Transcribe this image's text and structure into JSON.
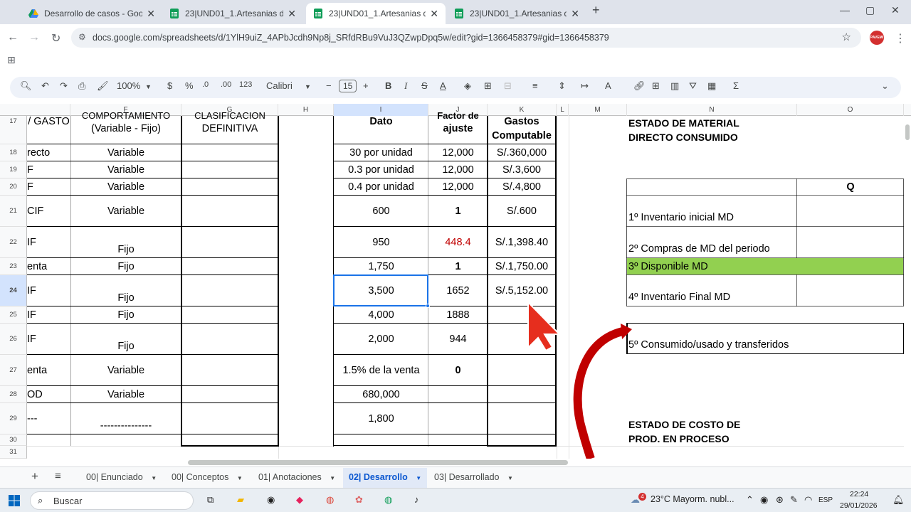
{
  "browser": {
    "tabs": [
      {
        "title": "Desarrollo de casos - Google D"
      },
      {
        "title": "23|UND01_1.Artesanias del Perú"
      },
      {
        "title": "23|UND01_1.Artesanias del Perú"
      },
      {
        "title": "23|UND01_1.Artesanias del Perú"
      }
    ],
    "url": "docs.google.com/spreadsheets/d/1YlH9uiZ_4APbJcdh9Np8j_SRfdRBu9VuJ3QZwpDpq5w/edit?gid=1366458379#gid=1366458379",
    "profile": "PAVEMI"
  },
  "toolbar": {
    "zoom": "100%",
    "currency": "$",
    "percent": "%",
    "dec_less": ".0",
    "dec_more": ".00",
    "number_format": "123",
    "font": "Calibri",
    "font_size": "15"
  },
  "columns": [
    {
      "label": "F"
    },
    {
      "label": "G"
    },
    {
      "label": "H"
    },
    {
      "label": "I"
    },
    {
      "label": "J"
    },
    {
      "label": "K"
    },
    {
      "label": "L"
    },
    {
      "label": "M"
    },
    {
      "label": "N"
    },
    {
      "label": "O"
    }
  ],
  "rows": [
    "17",
    "18",
    "19",
    "20",
    "21",
    "22",
    "23",
    "24",
    "25",
    "26",
    "27",
    "28",
    "29",
    "30",
    "31"
  ],
  "headers": {
    "e17": "/ GASTO",
    "f17_top": "COMPORTAMIENTO",
    "f17": "(Variable - Fijo)",
    "g17_top": "CLASIFICACION",
    "g17": "DEFINITIVA",
    "i17": "Dato",
    "j17_top": "Factor de",
    "j17": "ajuste",
    "k17_a": "Gastos",
    "k17_b": "Computable"
  },
  "table": {
    "e": [
      "recto",
      "F",
      "F",
      "CIF",
      "IF",
      "enta",
      "IF",
      "IF",
      "IF",
      "enta",
      "OD",
      "---"
    ],
    "f": [
      "Variable",
      "Variable",
      "Variable",
      "Variable",
      "Fijo",
      "Fijo",
      "Fijo",
      "Fijo",
      "Fijo",
      "Variable",
      "Variable",
      "---------------"
    ],
    "i": [
      "30 por unidad",
      "0.3 por unidad",
      "0.4 por unidad",
      "600",
      "950",
      "1,750",
      "3,500",
      "4,000",
      "2,000",
      "1.5% de la venta",
      "680,000",
      "1,800"
    ],
    "j": [
      "12,000",
      "12,000",
      "12,000",
      "1",
      "448.4",
      "1",
      "1652",
      "1888",
      "944",
      "0",
      "",
      ""
    ],
    "k": [
      "S/.360,000",
      "S/.3,600",
      "S/.4,800",
      "S/.600",
      "S/.1,398.40",
      "S/.1,750.00",
      "S/.5,152.00",
      "",
      "",
      "",
      "",
      ""
    ]
  },
  "material": {
    "title_1": "ESTADO DE MATERIAL",
    "title_2": "DIRECTO CONSUMIDO",
    "col_q": "Q",
    "items": [
      "1º Inventario inicial MD",
      "2º Compras de MD del periodo",
      "3º Disponible MD",
      "4º Inventario Final MD",
      "5º Consumido/usado y transferidos"
    ]
  },
  "proceso": {
    "title_1": "ESTADO DE COSTO DE",
    "title_2": "PROD. EN PROCESO"
  },
  "sheet_tabs": [
    {
      "label": "00| Enunciado"
    },
    {
      "label": "00| Conceptos"
    },
    {
      "label": "01| Anotaciones"
    },
    {
      "label": "02| Desarrollo"
    },
    {
      "label": "03| Desarrollado"
    }
  ],
  "taskbar": {
    "search": "Buscar",
    "weather": "23°C  Mayorm. nubl...",
    "lang": "ESP",
    "time": "22:24",
    "date": "29/01/2026",
    "badge": "4"
  },
  "colors": {
    "accent_blue": "#0b57d0",
    "highlight_green": "#92d050",
    "red_value": "#c00000",
    "cursor_red": "#e62e1e",
    "arrow_red": "#c00000"
  }
}
